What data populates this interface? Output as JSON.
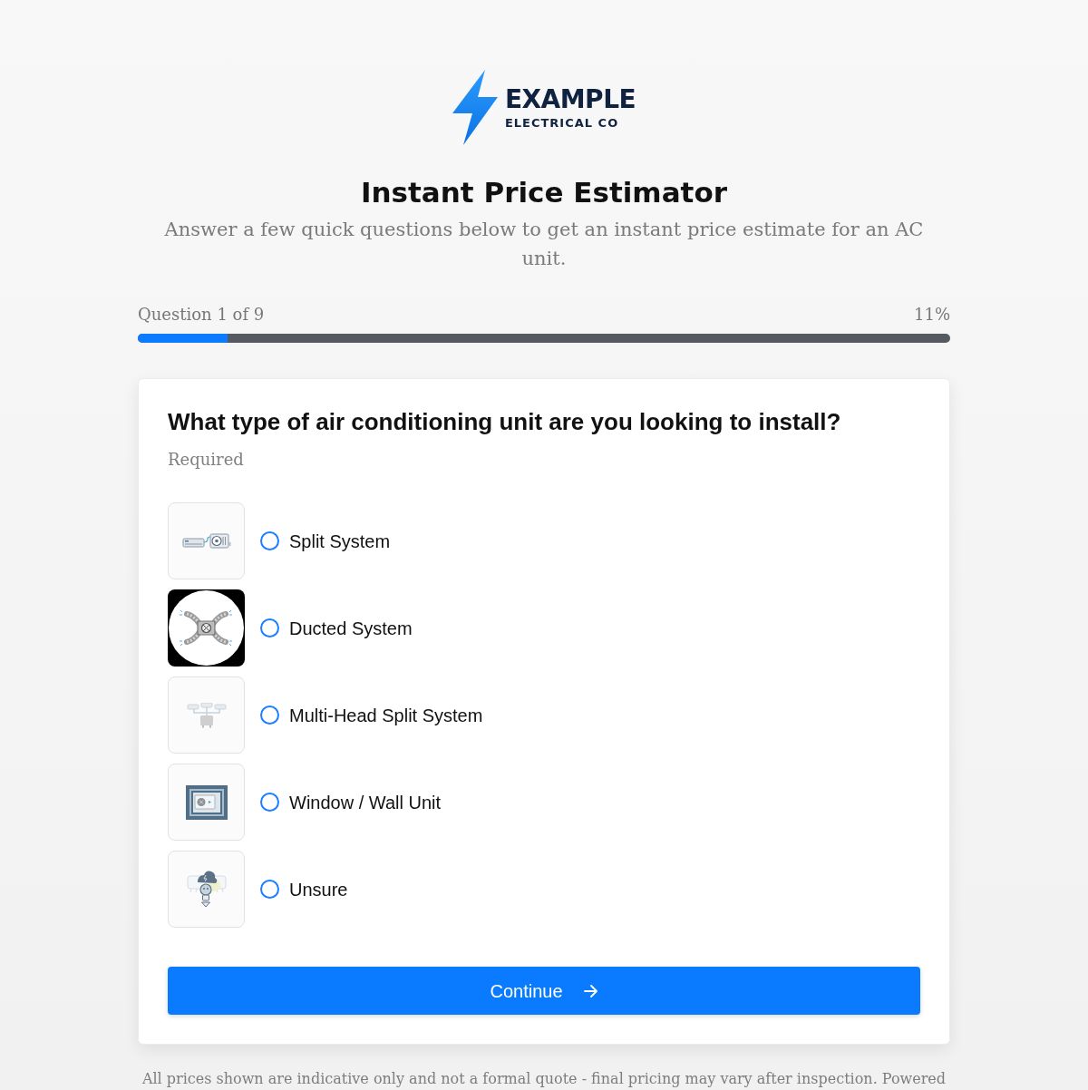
{
  "logo": {
    "name": "EXAMPLE",
    "tagline": "ELECTRICAL CO"
  },
  "title": "Instant Price Estimator",
  "subtitle": "Answer a few quick questions below to get an instant price estimate for an AC unit.",
  "progress": {
    "label": "Question 1 of 9",
    "percent": "11%",
    "level": 0.11
  },
  "question": {
    "text": "What type of air conditioning unit are you looking to install?",
    "note": "Required",
    "options": [
      {
        "kind": "split",
        "label": "Split System",
        "selected": false
      },
      {
        "kind": "ducted",
        "label": "Ducted System",
        "selected": false
      },
      {
        "kind": "multi-head",
        "label": "Multi-Head Split System",
        "selected": false
      },
      {
        "kind": "window",
        "label": "Window / Wall Unit",
        "selected": false
      },
      {
        "kind": "unsure",
        "label": "Unsure",
        "selected": false
      }
    ]
  },
  "continue_button": {
    "label": "Continue"
  },
  "footer": "All prices shown are indicative only and not a formal quote - final pricing may vary after inspection. Powered"
}
